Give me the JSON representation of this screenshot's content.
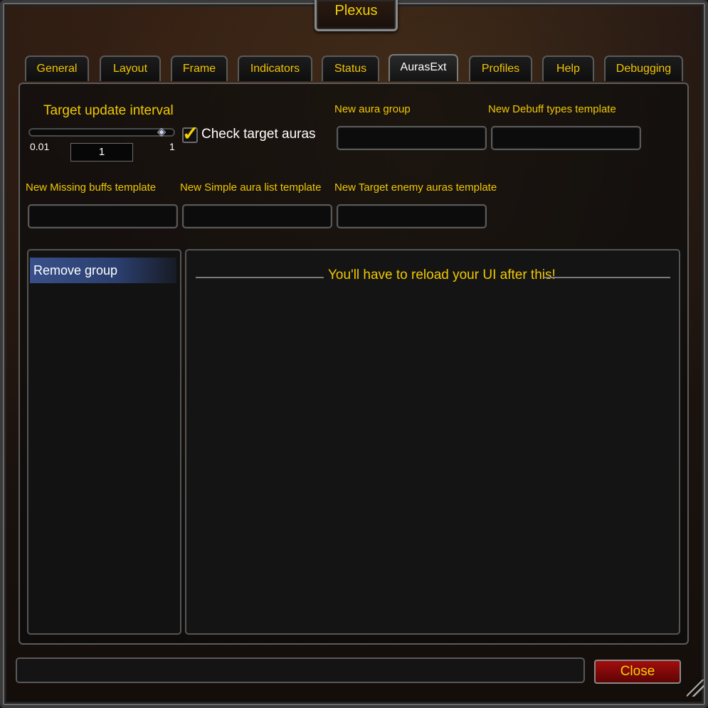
{
  "window": {
    "title": "Plexus"
  },
  "tabs": [
    {
      "label": "General"
    },
    {
      "label": "Layout"
    },
    {
      "label": "Frame"
    },
    {
      "label": "Indicators"
    },
    {
      "label": "Status"
    },
    {
      "label": "AurasExt",
      "active": true
    },
    {
      "label": "Profiles"
    },
    {
      "label": "Help"
    },
    {
      "label": "Debugging"
    }
  ],
  "settings": {
    "target_update_interval": {
      "label": "Target update interval",
      "min": "0.01",
      "max": "1",
      "value": "1"
    },
    "check_target_auras": {
      "label": "Check target auras",
      "checked": true
    },
    "new_aura_group": {
      "label": "New aura group",
      "value": ""
    },
    "new_debuff_types_template": {
      "label": "New Debuff types template",
      "value": ""
    },
    "new_missing_buffs_template": {
      "label": "New Missing buffs template",
      "value": ""
    },
    "new_simple_aura_list_template": {
      "label": "New Simple aura list template",
      "value": ""
    },
    "new_target_enemy_auras_template": {
      "label": "New Target enemy auras template",
      "value": ""
    }
  },
  "group_list": {
    "items": [
      {
        "label": "Remove group",
        "selected": true
      }
    ]
  },
  "content": {
    "heading": "You'll have to reload your UI after this!"
  },
  "footer": {
    "status_text": "",
    "close_label": "Close"
  },
  "colors": {
    "gold_text": "#f0c800",
    "selected_item": "#38508a",
    "close_button": "#a30d0d"
  }
}
